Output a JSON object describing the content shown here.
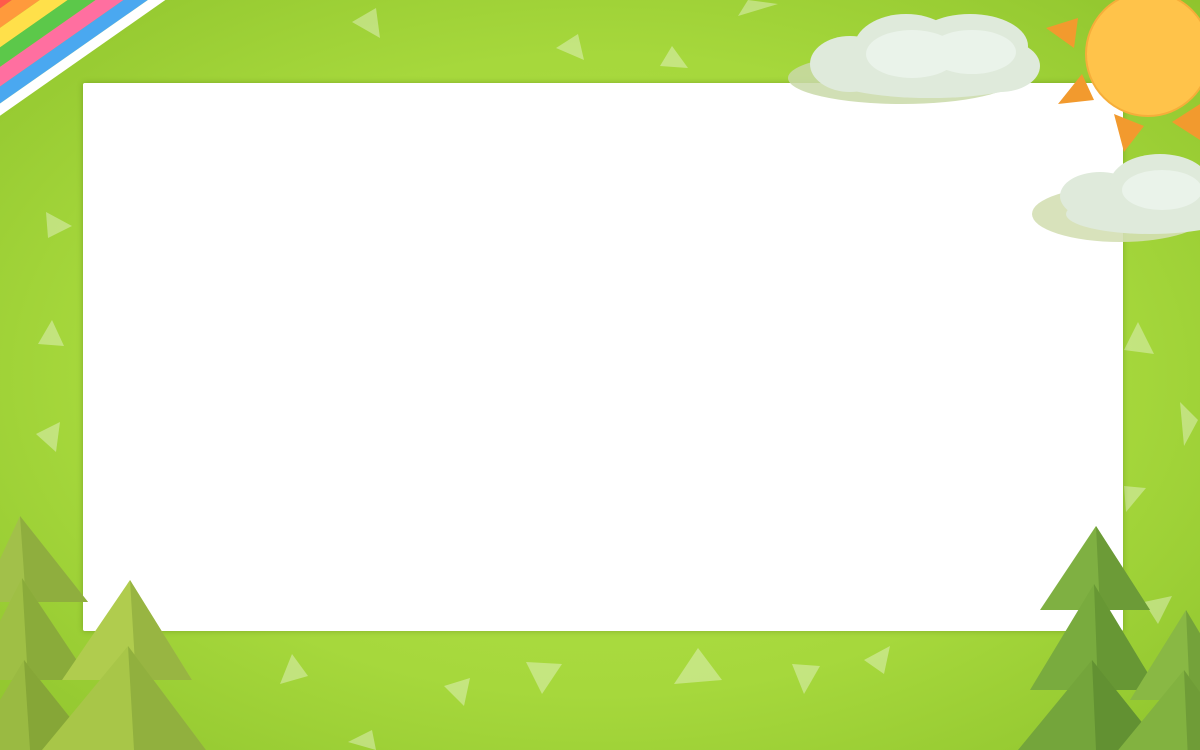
{
  "frame": {
    "theme": "nature",
    "colors": {
      "grass": "#a6d83c",
      "grass_dark": "#8fc42d",
      "panel": "#ffffff",
      "sun": "#ffc34a",
      "sun_rays": "#f29a2e",
      "cloud": "#e4eee3",
      "tree_light": "#a9c84a",
      "tree_dark": "#6fa23a"
    },
    "rainbow_stripes": [
      "#ff5a4a",
      "#ff9a3c",
      "#ffe04a",
      "#5cc84a",
      "#ff6fa0",
      "#4aa8f0",
      "#ffffff"
    ],
    "icons": [
      "rainbow-icon",
      "sun-icon",
      "cloud-icon",
      "pine-tree-icon",
      "triangle-confetti-icon"
    ]
  }
}
